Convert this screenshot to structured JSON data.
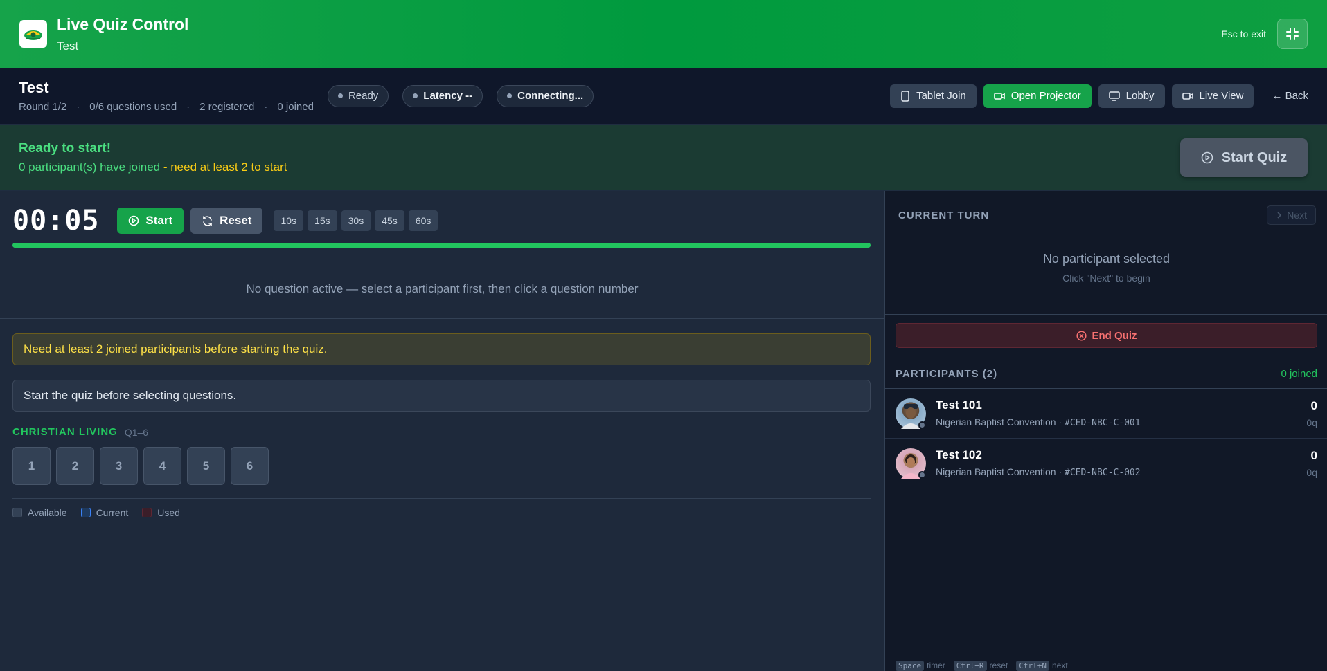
{
  "header": {
    "title": "Live Quiz Control",
    "subtitle": "Test",
    "esc_hint": "Esc to exit"
  },
  "subbar": {
    "title": "Test",
    "round": "Round 1/2",
    "questions_used": "0/6 questions used",
    "registered": "2 registered",
    "joined": "0 joined",
    "pills": {
      "status": "Ready",
      "latency": "Latency --",
      "connection": "Connecting..."
    },
    "actions": {
      "tablet": "Tablet Join",
      "projector": "Open Projector",
      "lobby": "Lobby",
      "live_view": "Live View",
      "back": "← Back"
    }
  },
  "banner": {
    "heading": "Ready to start!",
    "joined_text": "0 participant(s) have joined",
    "need_text": " - need at least 2 to start",
    "start_quiz": "Start Quiz"
  },
  "timer": {
    "display": "00:05",
    "start": "Start",
    "reset": "Reset",
    "presets": [
      "10s",
      "15s",
      "30s",
      "45s",
      "60s"
    ],
    "progress_fraction": 1.0
  },
  "question_area": {
    "empty_text": "No question active — select a participant first, then click a question number",
    "warning": "Need at least 2 joined participants before starting the quiz.",
    "info": "Start the quiz before selecting questions."
  },
  "category": {
    "name": "CHRISTIAN LIVING",
    "range": "Q1–6",
    "questions": [
      "1",
      "2",
      "3",
      "4",
      "5",
      "6"
    ]
  },
  "legend": {
    "available": "Available",
    "current": "Current",
    "used": "Used"
  },
  "current_turn": {
    "label": "CURRENT TURN",
    "next": "Next",
    "empty_title": "No participant selected",
    "empty_hint": "Click \"Next\" to begin",
    "end_quiz": "End Quiz"
  },
  "participants": {
    "header": "PARTICIPANTS (2)",
    "joined": "0 joined",
    "list": [
      {
        "name": "Test 101",
        "org": "Nigerian Baptist Convention · ",
        "code": "#CED-NBC-C-001",
        "score": "0",
        "questions": "0q"
      },
      {
        "name": "Test 102",
        "org": "Nigerian Baptist Convention · ",
        "code": "#CED-NBC-C-002",
        "score": "0",
        "questions": "0q"
      }
    ]
  },
  "shortcuts": {
    "space": "Space",
    "space_label": "timer",
    "reset_key": "Ctrl+R",
    "reset_label": "reset",
    "next_key": "Ctrl+N",
    "next_label": "next"
  },
  "colors": {
    "accent": "#16a34a",
    "warning": "#facc15",
    "danger": "#f87171"
  }
}
